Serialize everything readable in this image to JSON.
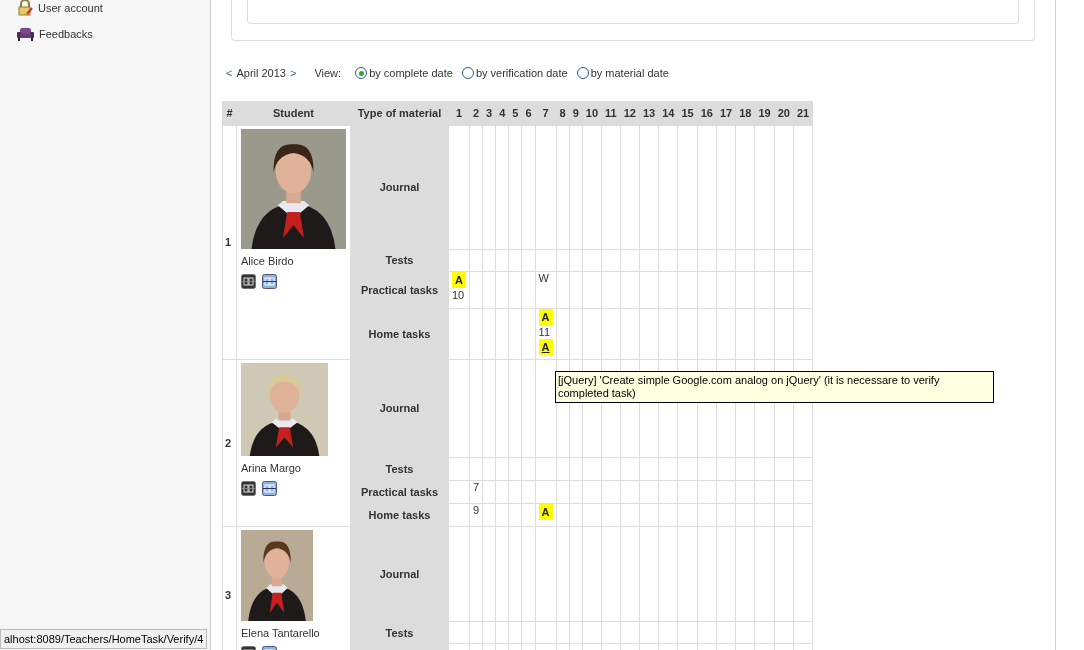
{
  "sidebar": {
    "items": [
      {
        "label": "User account"
      },
      {
        "label": "Feedbacks"
      }
    ]
  },
  "calendar_nav": {
    "prev": "<",
    "month": "April 2013",
    "next": ">",
    "view_label": "View:",
    "view_options": [
      {
        "label": "by complete date",
        "selected": true
      },
      {
        "label": "by verification date",
        "selected": false
      },
      {
        "label": "by material date",
        "selected": false
      }
    ]
  },
  "table": {
    "columns": [
      "#",
      "Student",
      "Type of material",
      "1",
      "2",
      "3",
      "4",
      "5",
      "6",
      "7",
      "8",
      "9",
      "10",
      "11",
      "12",
      "13",
      "14",
      "15",
      "16",
      "17",
      "18",
      "19",
      "20",
      "21"
    ],
    "students": [
      {
        "number": "1",
        "name": "Alice Birdo",
        "photo": {
          "kind": "picture"
        },
        "materials": [
          {
            "type": "Journal"
          },
          {
            "type": "Tests"
          },
          {
            "type": "Practical tasks",
            "cells": {
              "0": [
                {
                  "kind": "badge",
                  "text": "A"
                },
                {
                  "kind": "text",
                  "text": "10"
                }
              ],
              "6": [
                {
                  "kind": "text",
                  "text": "W"
                }
              ]
            }
          },
          {
            "type": "Home tasks",
            "cells": {
              "6": [
                {
                  "kind": "badge",
                  "text": "A"
                },
                {
                  "kind": "text",
                  "text": "11"
                },
                {
                  "kind": "underlined_badge",
                  "text": "A"
                }
              ]
            }
          }
        ]
      },
      {
        "number": "2",
        "name": "Arina Margo",
        "photo": {
          "kind": "picture"
        },
        "materials": [
          {
            "type": "Journal"
          },
          {
            "type": "Tests"
          },
          {
            "type": "Practical tasks",
            "cells": {
              "1": [
                {
                  "kind": "text",
                  "text": "7"
                }
              ]
            }
          },
          {
            "type": "Home tasks",
            "cells": {
              "1": [
                {
                  "kind": "text",
                  "text": "9"
                }
              ],
              "6": [
                {
                  "kind": "badge",
                  "text": "A"
                }
              ]
            }
          }
        ]
      },
      {
        "number": "3",
        "name": "Elena Tantarello",
        "photo": {
          "kind": "picture"
        },
        "materials": [
          {
            "type": "Journal"
          },
          {
            "type": "Tests"
          }
        ]
      }
    ]
  },
  "tooltip": "[jQuery] 'Create simple Google.com analog on jQuery' (it is necessare to verify completed task)",
  "status_bar": "alhost:8089/Teachers/HomeTask/Verify/4"
}
